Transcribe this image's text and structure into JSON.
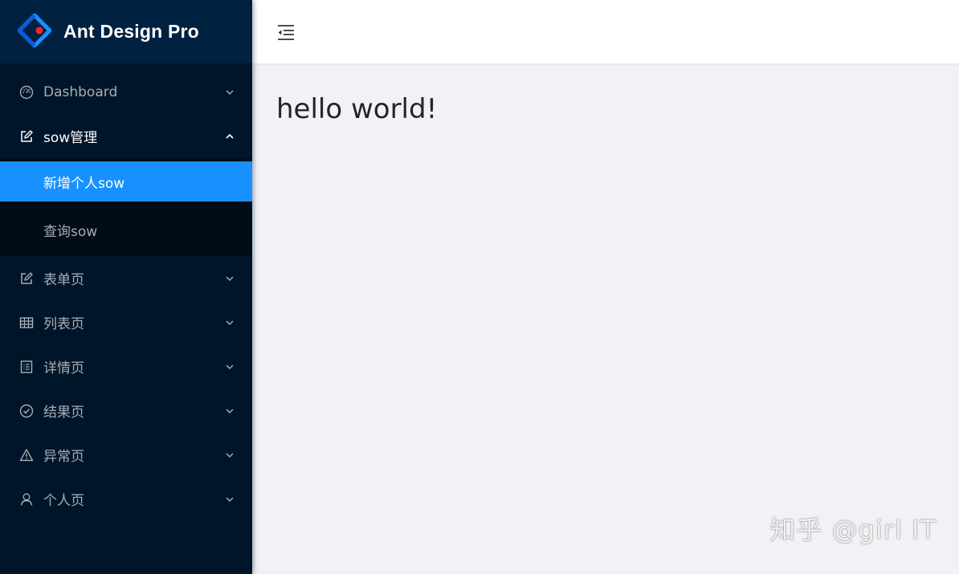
{
  "brand": {
    "title": "Ant Design Pro",
    "logo_icon": "ant-design-logo",
    "colors": {
      "primary": "#1890ff",
      "logo_blue": "#1890ff",
      "logo_red": "#f5222d"
    }
  },
  "header": {
    "trigger_icon": "menu-fold-icon"
  },
  "sidebar": {
    "items": [
      {
        "label": "Dashboard",
        "icon": "dashboard-icon",
        "arrow": "down"
      },
      {
        "label": "sow管理",
        "icon": "edit-icon",
        "arrow": "up",
        "open": true,
        "children": [
          {
            "label": "新增个人sow",
            "active": true
          },
          {
            "label": "查询sow"
          }
        ]
      },
      {
        "label": "表单页",
        "icon": "form-icon",
        "arrow": "down"
      },
      {
        "label": "列表页",
        "icon": "table-icon",
        "arrow": "down"
      },
      {
        "label": "详情页",
        "icon": "profile-icon",
        "arrow": "down"
      },
      {
        "label": "结果页",
        "icon": "check-circle-icon",
        "arrow": "down"
      },
      {
        "label": "异常页",
        "icon": "warning-icon",
        "arrow": "down"
      },
      {
        "label": "个人页",
        "icon": "user-icon",
        "arrow": "down"
      }
    ]
  },
  "main": {
    "heading": "hello world!"
  },
  "watermark": "知乎 @girl IT"
}
